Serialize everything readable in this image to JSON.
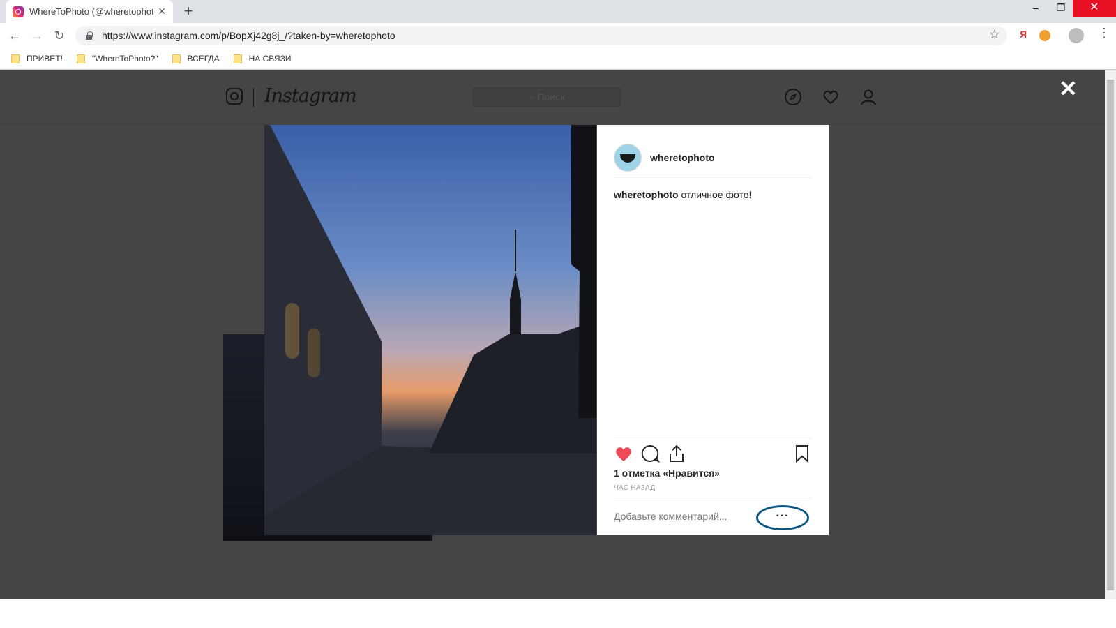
{
  "browser": {
    "tab_title": "WhereToPhoto (@wheretophoto",
    "url": "https://www.instagram.com/p/BopXj42g8j_/?taken-by=wheretophoto",
    "bookmarks": [
      "ПРИВЕТ!",
      "\"WhereToPhoto?\"",
      "ВСЕГДА",
      "НА СВЯЗИ"
    ],
    "ext_yandex": "Я"
  },
  "instagram": {
    "wordmark": "Instagram",
    "search_placeholder": "Поиск",
    "close_glyph": "✕"
  },
  "post": {
    "username": "wheretophoto",
    "caption_user": "wheretophoto",
    "caption_text": "отличное фото!",
    "likes_text": "1 отметка «Нравится»",
    "time_text": "ЧАС НАЗАД",
    "comment_placeholder": "Добавьте комментарий...",
    "more_glyph": "···",
    "liked": true,
    "accent_like": "#ed4956",
    "highlight_color": "#0e5780"
  }
}
